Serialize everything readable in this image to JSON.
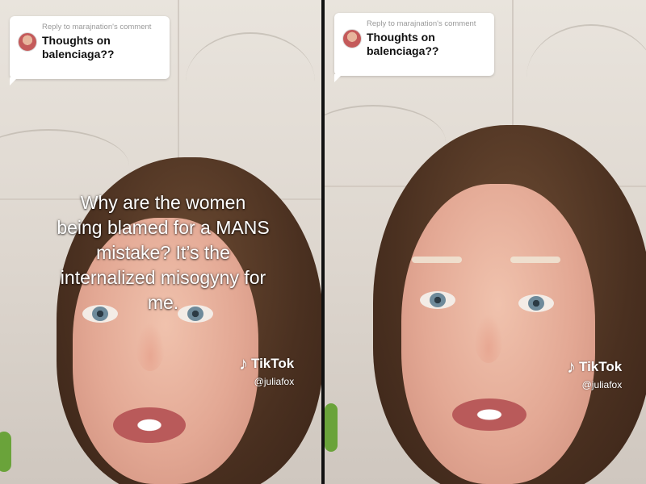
{
  "panels": [
    {
      "reply": {
        "header": "Reply to marajnation's comment",
        "text_line1": "Thoughts on",
        "text_line2": "balenciaga??"
      },
      "caption": [
        "Why are the women",
        "being blamed for a MANS",
        "mistake? It’s the",
        "internalized misogyny for",
        "me."
      ],
      "watermark": {
        "brand": "TikTok",
        "handle": "@juliafox",
        "icon": "tiktok-note-icon"
      }
    },
    {
      "reply": {
        "header": "Reply to marajnation's comment",
        "text_line1": "Thoughts on",
        "text_line2": "balenciaga??"
      },
      "watermark": {
        "brand": "TikTok",
        "handle": "@juliafox",
        "icon": "tiktok-note-icon"
      }
    }
  ],
  "colors": {
    "bubble": "#ffffff",
    "caption_text": "#ffffff",
    "wall": "#e2dcd4"
  }
}
